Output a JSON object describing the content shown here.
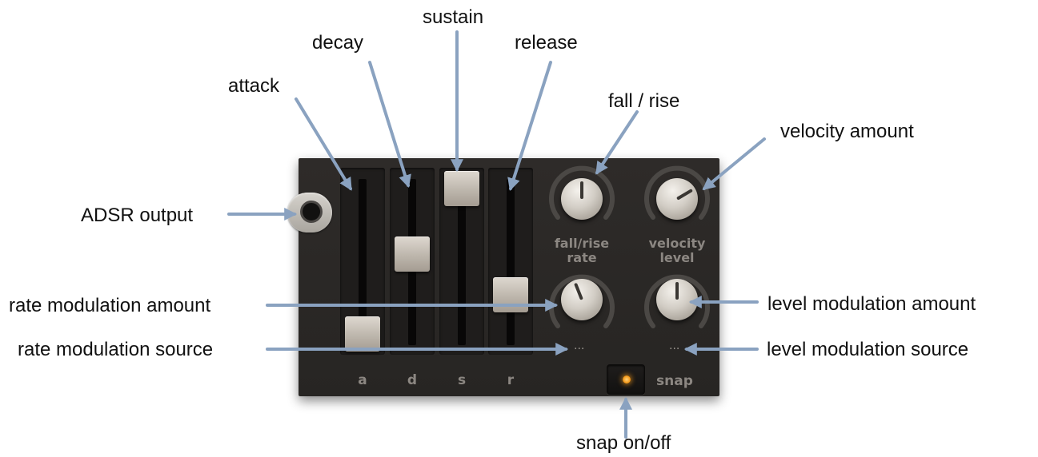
{
  "callouts": {
    "attack": "attack",
    "decay": "decay",
    "sustain": "sustain",
    "release": "release",
    "fall_rise": "fall / rise",
    "velocity_amount": "velocity amount",
    "adsr_output": "ADSR output",
    "rate_mod_amount": "rate modulation amount",
    "rate_mod_source": "rate modulation source",
    "level_mod_amount": "level modulation amount",
    "level_mod_source": "level modulation source",
    "snap_onoff": "snap on/off"
  },
  "panel": {
    "sliders": [
      {
        "label": "a",
        "value": 0.0
      },
      {
        "label": "d",
        "value": 0.55
      },
      {
        "label": "s",
        "value": 1.0
      },
      {
        "label": "r",
        "value": 0.27
      }
    ],
    "knobs": {
      "fall_rise": {
        "label_line1": "fall/rise",
        "label_line2": "rate",
        "value": 0.5
      },
      "velocity": {
        "label_line1": "velocity",
        "label_line2": "level",
        "value": 0.72
      },
      "rate_mod": {
        "value": 0.42
      },
      "level_mod": {
        "value": 0.5
      }
    },
    "mod_source_rate": "...",
    "mod_source_level": "...",
    "snap": {
      "label": "snap",
      "on": true
    }
  },
  "colors": {
    "arrow": "#8aa2c0",
    "panel": "#2b2927",
    "led": "#f59a1a",
    "label": "#8c8782"
  }
}
